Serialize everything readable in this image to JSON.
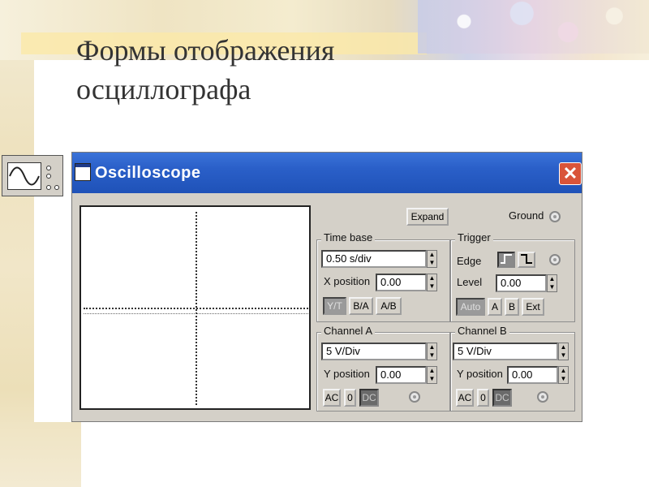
{
  "slide": {
    "title_line1": "Формы отображения",
    "title_line2": "осциллографа"
  },
  "window": {
    "title": "Oscilloscope",
    "close_glyph": "✕"
  },
  "controls": {
    "expand_label": "Expand",
    "ground_label": "Ground"
  },
  "time_base": {
    "title": "Time base",
    "value": "0.50 s/div",
    "x_position_label": "X position",
    "x_position_value": "0.00",
    "mode_buttons": [
      "Y/T",
      "B/A",
      "A/B"
    ]
  },
  "trigger": {
    "title": "Trigger",
    "edge_label": "Edge",
    "level_label": "Level",
    "level_value": "0.00",
    "source_buttons": [
      "Auto",
      "A",
      "B",
      "Ext"
    ]
  },
  "channel_a": {
    "title": "Channel A",
    "scale": "5 V/Div",
    "y_position_label": "Y position",
    "y_position_value": "0.00",
    "coupling_buttons": [
      "AC",
      "0",
      "DC"
    ]
  },
  "channel_b": {
    "title": "Channel B",
    "scale": "5 V/Div",
    "y_position_label": "Y position",
    "y_position_value": "0.00",
    "coupling_buttons": [
      "AC",
      "0",
      "DC"
    ]
  },
  "icons": {
    "scope_icon": "sine-wave-icon",
    "spin_up": "▲",
    "spin_down": "▼"
  },
  "colors": {
    "titlebar": "#2a5fc8",
    "panel": "#d4d0c8",
    "close_button": "#d9543a"
  }
}
